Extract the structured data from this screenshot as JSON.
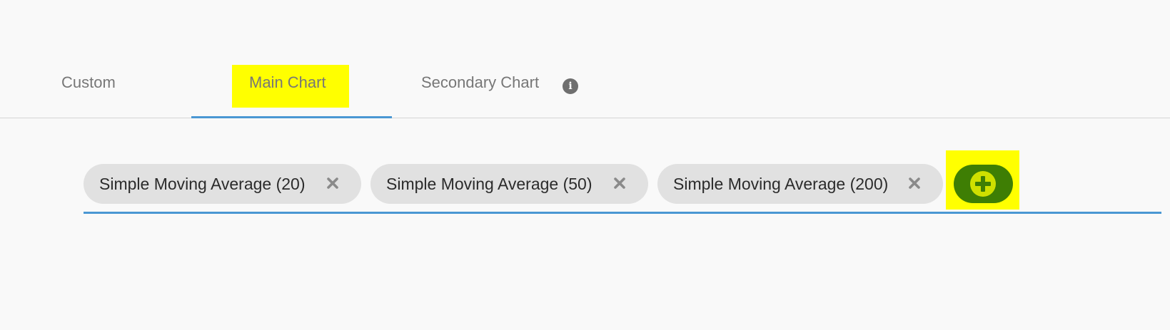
{
  "tabs": [
    {
      "label": "Custom",
      "active": false
    },
    {
      "label": "Main Chart",
      "active": true,
      "highlighted": true
    },
    {
      "label": "Secondary Chart",
      "active": false,
      "icon": "info-icon"
    }
  ],
  "indicators": [
    {
      "label": "Simple Moving Average (20)",
      "remove_icon": "close-icon"
    },
    {
      "label": "Simple Moving Average (50)",
      "remove_icon": "close-icon"
    },
    {
      "label": "Simple Moving Average (200)",
      "remove_icon": "close-icon"
    }
  ],
  "add_button": {
    "icon": "plus-circle-icon",
    "highlighted": true
  },
  "colors": {
    "accent_underline": "#4a97d3",
    "highlight": "#ffff00",
    "add_button_bg": "#3e7e04",
    "chip_bg": "#e1e1e1"
  }
}
